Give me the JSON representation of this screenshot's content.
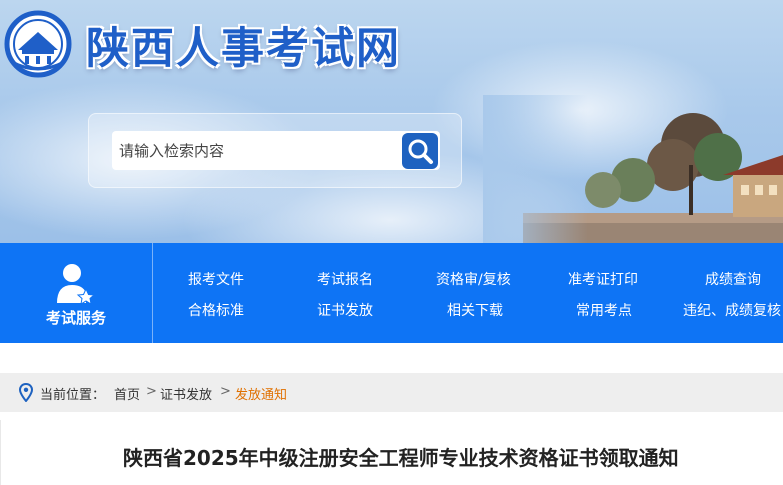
{
  "header": {
    "site_title": "陕西人事考试网",
    "logo_icon": "emblem-icon"
  },
  "search": {
    "placeholder": "请输入检索内容",
    "value": "",
    "button_icon": "search-icon"
  },
  "nav": {
    "service_label": "考试服务",
    "service_icon": "user-star-icon",
    "row1": [
      "报考文件",
      "考试报名",
      "资格审/复核",
      "准考证打印",
      "成绩查询"
    ],
    "row2": [
      "合格标准",
      "证书发放",
      "相关下载",
      "常用考点",
      "违纪、成绩复核"
    ]
  },
  "breadcrumb": {
    "label": "当前位置：",
    "items": [
      "首页",
      "证书发放",
      "发放通知"
    ],
    "separator": ">"
  },
  "article": {
    "title": "陕西省2025年中级注册安全工程师专业技术资格证书领取通知"
  },
  "colors": {
    "nav_blue": "#0e74f5",
    "title_blue": "#1f5fc8",
    "current_crumb": "#e07000"
  }
}
